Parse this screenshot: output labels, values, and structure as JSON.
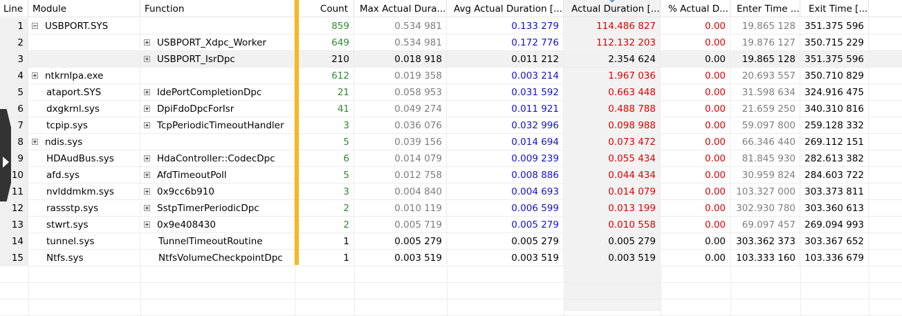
{
  "columns": [
    {
      "key": "line",
      "label": "Line"
    },
    {
      "key": "module",
      "label": "Module"
    },
    {
      "key": "function",
      "label": "Function"
    },
    {
      "key": "count",
      "label": "Count"
    },
    {
      "key": "max",
      "label": "Max Actual Dura..."
    },
    {
      "key": "avg",
      "label": "Avg Actual Duration [..."
    },
    {
      "key": "actual",
      "label": "Actual Duration [..."
    },
    {
      "key": "pct",
      "label": "% Actual D..."
    },
    {
      "key": "enter",
      "label": "Enter Time ..."
    },
    {
      "key": "exit",
      "label": "Exit Time [..."
    }
  ],
  "rows": [
    {
      "line": "1",
      "module": "USBPORT.SYS",
      "module_expander": "minus",
      "function": "",
      "function_expander": "",
      "count": "859",
      "max": "0.534 981",
      "avg": "0.133 279",
      "actual": "114.486 827",
      "pct": "0.00",
      "enter": "19.865 128",
      "exit": "351.375 596"
    },
    {
      "line": "2",
      "module": "",
      "module_expander": "",
      "function": "USBPORT_Xdpc_Worker",
      "function_expander": "plus",
      "count": "649",
      "max": "0.534 981",
      "avg": "0.172 776",
      "actual": "112.132 203",
      "pct": "0.00",
      "enter": "19.876 127",
      "exit": "350.715 229"
    },
    {
      "line": "3",
      "module": "",
      "module_expander": "",
      "function": "USBPORT_IsrDpc",
      "function_expander": "plus",
      "count": "210",
      "max": "0.018 918",
      "avg": "0.011 212",
      "actual": "2.354 624",
      "pct": "0.00",
      "enter": "19.865 128",
      "exit": "351.375 596",
      "selected": true
    },
    {
      "line": "4",
      "module": "ntkrnlpa.exe",
      "module_expander": "plus",
      "function": "",
      "function_expander": "",
      "count": "612",
      "max": "0.019 358",
      "avg": "0.003 214",
      "actual": "1.967 036",
      "pct": "0.00",
      "enter": "20.693 557",
      "exit": "350.710 829"
    },
    {
      "line": "5",
      "module": "ataport.SYS",
      "module_expander": "",
      "function": "IdePortCompletionDpc",
      "function_expander": "plus",
      "count": "21",
      "max": "0.058 953",
      "avg": "0.031 592",
      "actual": "0.663 448",
      "pct": "0.00",
      "enter": "31.598 634",
      "exit": "324.916 475"
    },
    {
      "line": "6",
      "module": "dxgkrnl.sys",
      "module_expander": "",
      "function": "DpiFdoDpcForIsr",
      "function_expander": "plus",
      "count": "41",
      "max": "0.049 274",
      "avg": "0.011 921",
      "actual": "0.488 788",
      "pct": "0.00",
      "enter": "21.659 250",
      "exit": "340.310 816"
    },
    {
      "line": "7",
      "module": "tcpip.sys",
      "module_expander": "",
      "function": "TcpPeriodicTimeoutHandler",
      "function_expander": "plus",
      "count": "3",
      "max": "0.036 076",
      "avg": "0.032 996",
      "actual": "0.098 988",
      "pct": "0.00",
      "enter": "59.097 800",
      "exit": "259.128 332"
    },
    {
      "line": "8",
      "module": "ndis.sys",
      "module_expander": "plus",
      "function": "",
      "function_expander": "",
      "count": "5",
      "max": "0.039 156",
      "avg": "0.014 694",
      "actual": "0.073 472",
      "pct": "0.00",
      "enter": "66.346 440",
      "exit": "269.112 151"
    },
    {
      "line": "9",
      "module": "HDAudBus.sys",
      "module_expander": "",
      "function": "HdaController::CodecDpc",
      "function_expander": "plus",
      "count": "6",
      "max": "0.014 079",
      "avg": "0.009 239",
      "actual": "0.055 434",
      "pct": "0.00",
      "enter": "81.845 930",
      "exit": "282.613 382"
    },
    {
      "line": "10",
      "module": "afd.sys",
      "module_expander": "",
      "function": "AfdTimeoutPoll",
      "function_expander": "plus",
      "count": "5",
      "max": "0.012 758",
      "avg": "0.008 886",
      "actual": "0.044 434",
      "pct": "0.00",
      "enter": "30.959 824",
      "exit": "284.603 722"
    },
    {
      "line": "11",
      "module": "nvlddmkm.sys",
      "module_expander": "",
      "function": "0x9cc6b910",
      "function_expander": "plus",
      "count": "3",
      "max": "0.004 840",
      "avg": "0.004 693",
      "actual": "0.014 079",
      "pct": "0.00",
      "enter": "103.327 000",
      "exit": "303.373 811"
    },
    {
      "line": "12",
      "module": "rassstp.sys",
      "module_expander": "",
      "function": "SstpTimerPeriodicDpc",
      "function_expander": "plus",
      "count": "2",
      "max": "0.010 119",
      "avg": "0.006 599",
      "actual": "0.013 199",
      "pct": "0.00",
      "enter": "302.930 780",
      "exit": "303.360 613"
    },
    {
      "line": "13",
      "module": "stwrt.sys",
      "module_expander": "",
      "function": "0x9e408430",
      "function_expander": "plus",
      "count": "2",
      "max": "0.005 719",
      "avg": "0.005 279",
      "actual": "0.010 558",
      "pct": "0.00",
      "enter": "69.097 457",
      "exit": "269.094 993"
    },
    {
      "line": "14",
      "module": "tunnel.sys",
      "module_expander": "",
      "function": "TunnelTimeoutRoutine",
      "function_expander": "",
      "count": "1",
      "max": "0.005 279",
      "avg": "0.005 279",
      "actual": "0.005 279",
      "pct": "0.00",
      "enter": "303.362 373",
      "exit": "303.367 652"
    },
    {
      "line": "15",
      "module": "Ntfs.sys",
      "module_expander": "",
      "function": "NtfsVolumeCheckpointDpc",
      "function_expander": "",
      "count": "1",
      "max": "0.003 519",
      "avg": "0.003 519",
      "actual": "0.003 519",
      "pct": "0.00",
      "enter": "103.333 160",
      "exit": "103.336 679"
    }
  ],
  "colors": {
    "count_green": "#2f8a2f",
    "avg_blue": "#1010d0",
    "actual_red": "#e00000",
    "gray_text": "#7d7d7d",
    "divider_gold": "#f5b921"
  },
  "icons": {
    "expand": "plus-box",
    "collapse": "minus-box",
    "sort": "sort-descending-arrow",
    "side_flyout": "chevron-right"
  }
}
